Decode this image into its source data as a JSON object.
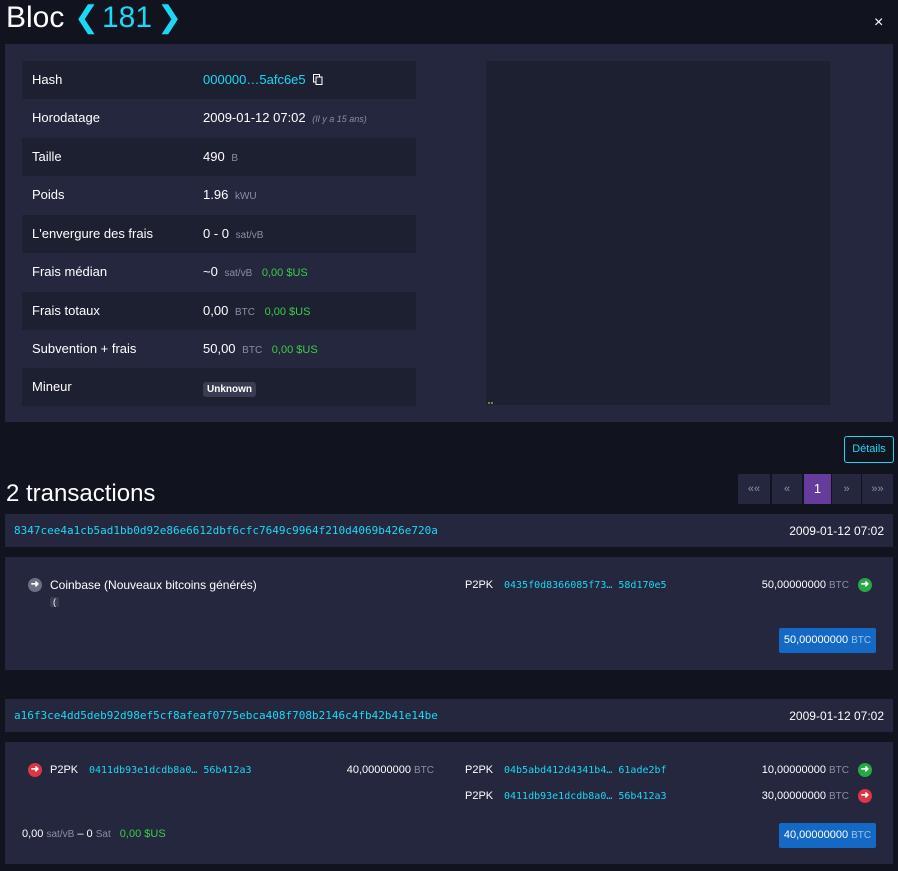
{
  "header": {
    "title": "Bloc",
    "prev_arrow": "❮",
    "block_number": "181",
    "next_arrow": "❯",
    "close": "×"
  },
  "block": {
    "rows": [
      {
        "label": "Hash",
        "value": "000000…5afc6e5",
        "copy_icon": "copy-icon"
      },
      {
        "label": "Horodatage",
        "value": "2009-01-12 07:02",
        "note": "(Il y a 15 ans)"
      },
      {
        "label": "Taille",
        "value": "490",
        "unit": "B"
      },
      {
        "label": "Poids",
        "value": "1.96",
        "unit": "kWU"
      },
      {
        "label": "L'envergure des frais",
        "value": "0 - 0",
        "unit": "sat/vB"
      },
      {
        "label": "Frais médian",
        "value": "~0",
        "unit": "sat/vB",
        "fiat": "0,00 $US"
      },
      {
        "label": "Frais totaux",
        "value": "0,00",
        "unit": "BTC",
        "fiat": "0,00 $US"
      },
      {
        "label": "Subvention + frais",
        "value": "50,00",
        "unit": "BTC",
        "fiat": "0,00 $US"
      },
      {
        "label": "Mineur",
        "badge": "Unknown"
      }
    ]
  },
  "details_button": "Détails",
  "transactions": {
    "count_label": "2 transactions",
    "pagination": [
      "««",
      "«",
      "1",
      "»",
      "»»"
    ],
    "active_page": "1",
    "items": [
      {
        "txid": "8347cee4a1cb5ad1bb0d92e86e6612dbf6cfc7649c9964f210d4069b426e720a",
        "timestamp": "2009-01-12 07:02",
        "input": {
          "label": "Coinbase (Nouveaux bitcoins générés)",
          "sub": "("
        },
        "outputs": [
          {
            "type": "P2PK",
            "address": "0435f0d8366085f73… 58d170e5",
            "amount": "50,00000000",
            "unit": "BTC",
            "status": "unspent"
          }
        ],
        "total": "50,00000000",
        "total_unit": "BTC"
      },
      {
        "txid": "a16f3ce4dd5deb92d98ef5cf8afeaf0775ebca408f708b2146c4fb42b41e14be",
        "timestamp": "2009-01-12 07:02",
        "input": {
          "type": "P2PK",
          "address": "0411db93e1dcdb8a0… 56b412a3",
          "amount": "40,00000000",
          "unit": "BTC"
        },
        "outputs": [
          {
            "type": "P2PK",
            "address": "04b5abd412d4341b4… 61ade2bf",
            "amount": "10,00000000",
            "unit": "BTC",
            "status": "unspent"
          },
          {
            "type": "P2PK",
            "address": "0411db93e1dcdb8a0… 56b412a3",
            "amount": "30,00000000",
            "unit": "BTC",
            "status": "spent"
          }
        ],
        "fee_rate": "0,00",
        "fee_rate_unit": "sat/vB",
        "fee_sep": "–",
        "fee": "0",
        "fee_unit": "Sat",
        "fee_fiat": "0,00 $US",
        "total": "40,00000000",
        "total_unit": "BTC"
      }
    ]
  },
  "colors": {
    "accent": "#1bd8f4",
    "panel": "#24273e",
    "row_dark": "#1d2031",
    "green": "#3bcc49",
    "red": "#dc3545",
    "button_blue": "#1469c4",
    "active_page": "#653b9c"
  }
}
